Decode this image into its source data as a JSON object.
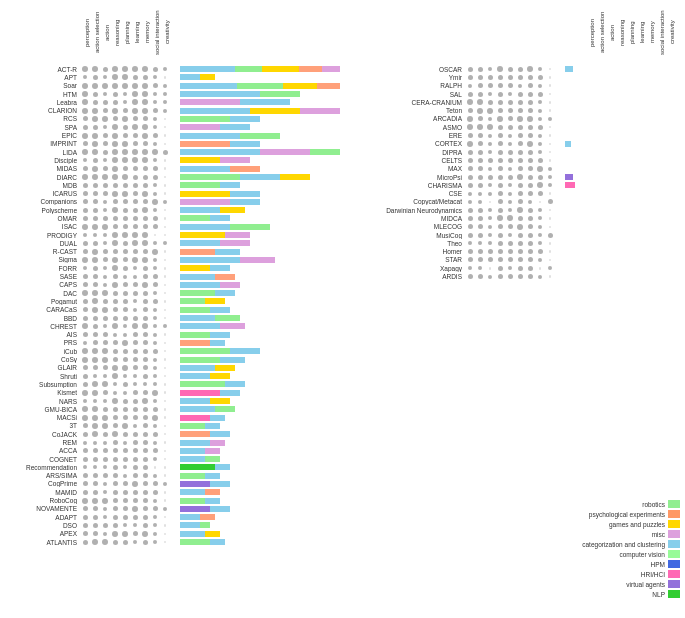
{
  "colors": {
    "robotics": "#90EE90",
    "psych": "#FF9966",
    "games": "#FFD700",
    "misc": "#DDA0DD",
    "categorization": "#87CEEB",
    "computer_vision": "#98FB98",
    "HPM": "#4169E1",
    "HRI": "#FF69B4",
    "virtual": "#9370DB",
    "NLP": "#32CD32",
    "perc": "#87CEEB",
    "action": "#90EE90",
    "reasoning": "#FFD700",
    "planning": "#FFA07A",
    "learning": "#DDA0DD",
    "memory": "#87CEEB",
    "social": "#98FB98",
    "creativity": "#FF69B4"
  },
  "left_rows": [
    "ACT-R",
    "APT",
    "Soar",
    "HTM",
    "Leabra",
    "CLARION",
    "RCS",
    "SPA",
    "EPIC",
    "IMPRINT",
    "LIDA",
    "Disciple",
    "MIDAS",
    "DIARC",
    "MDB",
    "ICARUS",
    "Companions",
    "Polyscheme",
    "OMAR",
    "ISAC",
    "PRODIGY",
    "DUAL",
    "R-CAST",
    "Sigma",
    "FORR",
    "SASE",
    "CAPS",
    "DAC",
    "Pogamut",
    "CARACaS",
    "BBD",
    "CHREST",
    "AIS",
    "PRS",
    "iCub",
    "CoSy",
    "GLAIR",
    "Shruti",
    "Subsumption",
    "Kismet",
    "NARS",
    "GMU-BICA",
    "MACSi",
    "3T",
    "CoJACK",
    "REM",
    "ACCA",
    "COGNET",
    "Recommendation",
    "ARS/SIMA",
    "CogPrime",
    "MAMID",
    "RoboCog",
    "NOVAMENTE",
    "ADAPT",
    "DSO",
    "APEX",
    "ATLANTIS"
  ],
  "right_rows": [
    "OSCAR",
    "Ymir",
    "RALPH",
    "SAL",
    "CERA-CRANIUM",
    "Teton",
    "ARCADIA",
    "ASMO",
    "ERE",
    "CORTEX",
    "DIPRA",
    "CELTS",
    "MAX",
    "MicroPsi",
    "CHARISMA",
    "CSE",
    "Copycat/Metacat",
    "Darwinian Neurodynamics",
    "MIDCA",
    "MLECOG",
    "MusiCog",
    "Theo",
    "Homer",
    "STAR",
    "Xapagy",
    "ARDIS"
  ],
  "col_headers": [
    "perception",
    "action selection",
    "action",
    "reasoning",
    "planning",
    "learning",
    "memory",
    "social interaction",
    "creativity"
  ],
  "legend": [
    {
      "label": "robotics",
      "color": "#90EE90"
    },
    {
      "label": "psychological experiments",
      "color": "#FF9966"
    },
    {
      "label": "games and puzzles",
      "color": "#FFD700"
    },
    {
      "label": "misc",
      "color": "#DDA0DD"
    },
    {
      "label": "categorization and clustering",
      "color": "#87CEEB"
    },
    {
      "label": "computer vision",
      "color": "#98FB98"
    },
    {
      "label": "HPM",
      "color": "#4169E1"
    },
    {
      "label": "HRI/HCI",
      "color": "#FF69B4"
    },
    {
      "label": "virtual agents",
      "color": "#9370DB"
    },
    {
      "label": "NLP",
      "color": "#32CD32"
    }
  ]
}
